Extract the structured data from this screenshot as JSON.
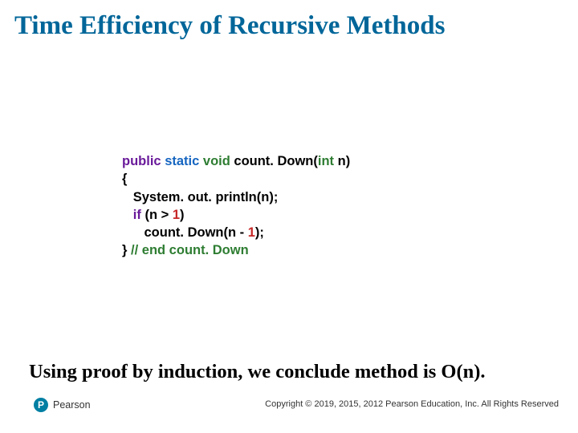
{
  "title": "Time Efficiency of Recursive Methods",
  "code": {
    "kw_public": "public",
    "kw_static": "static",
    "kw_void": "void",
    "sig_name": " count. Down(",
    "kw_int": "int",
    "sig_end": " n)",
    "lbrace": "{",
    "line_print": "   System. out. println(n);",
    "kw_if": "if",
    "if_cond_pre": " (n > ",
    "num1a": "1",
    "if_cond_post": ")",
    "recurse_pre": "      count. Down(n - ",
    "num1b": "1",
    "recurse_post": ");",
    "rbrace": "} ",
    "comment_end": "// end count. Down"
  },
  "conclusion": "Using proof by induction, we conclude method is O(n).",
  "footer": {
    "brand_initial": "P",
    "brand_name": "Pearson",
    "copyright": "Copyright © 2019, 2015, 2012 Pearson Education, Inc. All Rights Reserved"
  }
}
